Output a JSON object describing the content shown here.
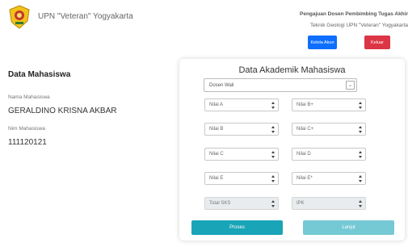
{
  "header": {
    "app_title": "UPN \"Veteran\" Yogyakarta",
    "title": "Pengajuan Dosen Pembimbing Tugas Akhir",
    "subtitle": "Teknik Geologi UPN \"Veteran\" Yogyakarta",
    "account_button": "Kelola Akun",
    "logout_button": "Keluar"
  },
  "student": {
    "section_title": "Data Mahasiswa",
    "name_label": "Nama Mahasiswa",
    "name_value": "GERALDINO KRISNA AKBAR",
    "nim_label": "Nim Mahasiswa",
    "nim_value": "111120121"
  },
  "academic": {
    "title": "Data Akademik Mahasiswa",
    "dosen_select": "Dosen Wali",
    "fields": {
      "nilai_a": "Nilai A",
      "nilai_b_plus": "Nilai B+",
      "nilai_b": "Nilai B",
      "nilai_c_plus": "Nilai C+",
      "nilai_c": "Nilai C",
      "nilai_d": "Nilai D",
      "nilai_e": "Nilai E",
      "nilai_e_star": "Nilai E*",
      "total_sks": "Total SKS",
      "ipk": "IPK"
    },
    "proses_button": "Proses",
    "lanjut_button": "Lanjut"
  },
  "colors": {
    "primary": "#0d6efd",
    "danger": "#dc3545",
    "info": "#1aa4b8",
    "info_light": "#74c9d4"
  }
}
